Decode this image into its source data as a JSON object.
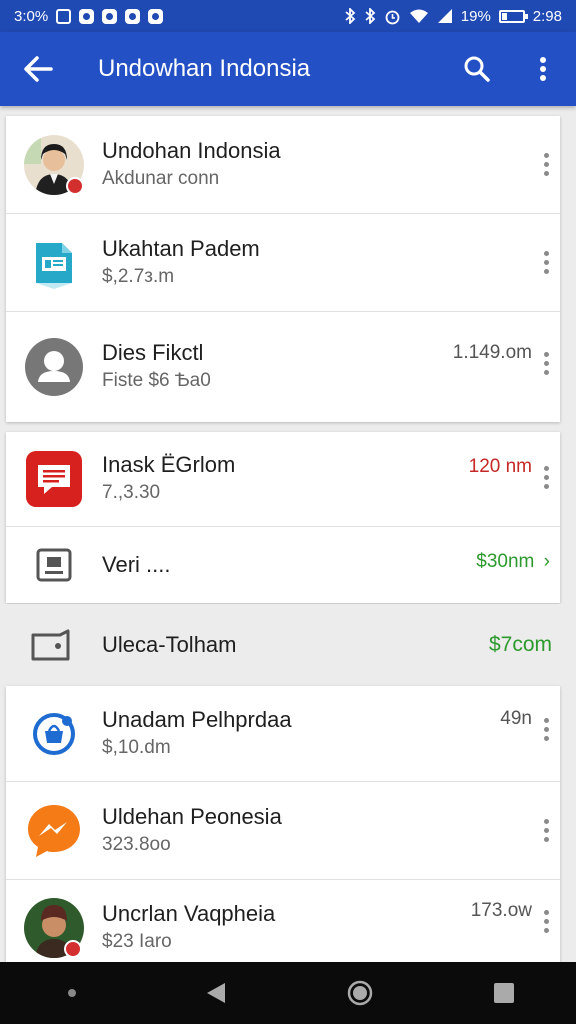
{
  "status_bar": {
    "time_left": "3:0%",
    "battery_pct": "19%",
    "time": "2:98",
    "battery_level": 0.19
  },
  "app_bar": {
    "title": "Undowhan Indonsia",
    "back_icon": "arrow-left-icon",
    "search_icon": "search-icon",
    "more_icon": "more-vert-icon"
  },
  "card1": {
    "items": [
      {
        "primary": "Undohan Indonsia",
        "secondary": "Akdunar conn",
        "meta": "",
        "icon": "avatar-user"
      },
      {
        "primary": "Ukahtan Padem",
        "secondary": "$,2.7з.m",
        "meta": "",
        "icon": "document-app-icon"
      },
      {
        "primary": "Dies Fikctl",
        "secondary": "Fiste $6 Ѣa0",
        "meta": "1.149.om",
        "icon": "person-placeholder-icon"
      }
    ]
  },
  "card2": {
    "items": [
      {
        "primary": "Inask ЁGrlom",
        "secondary": "7.,3.30",
        "meta": "120 nm",
        "meta_color": "#c62828",
        "icon": "message-app-icon"
      },
      {
        "primary": "Veri ....",
        "secondary": "",
        "meta": "$30nm",
        "meta_color": "#2e9a2e",
        "icon": "id-card-icon",
        "chevron": "›"
      }
    ]
  },
  "section": {
    "primary": "Ulecа-Tolham",
    "meta": "$7com",
    "meta_color": "#2e9a2e",
    "icon": "wallet-icon"
  },
  "card3": {
    "items": [
      {
        "primary": "Unadam Pelhprdaa",
        "secondary": "$,10.dm",
        "meta": "49n",
        "icon": "store-badge-icon"
      },
      {
        "primary": "Uldehan Peonesia",
        "secondary": "323.8oo",
        "meta": "",
        "icon": "messenger-icon"
      },
      {
        "primary": "Uncrlan Vaqpheia",
        "secondary": "$23 Іaro",
        "meta": "173.ow",
        "icon": "avatar-user"
      }
    ]
  },
  "colors": {
    "status_bar": "#1f49b3",
    "app_bar": "#2350c4",
    "green": "#2e9a2e",
    "red": "#c62828"
  }
}
